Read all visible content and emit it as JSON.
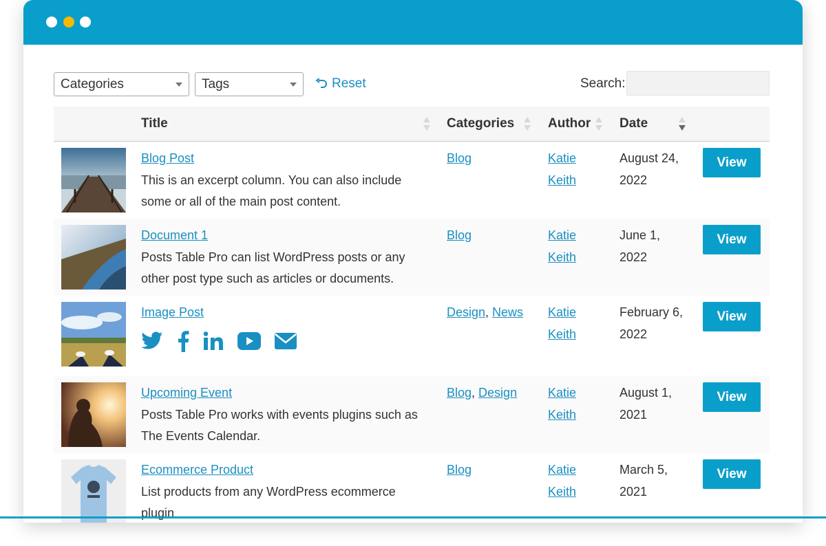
{
  "filters": {
    "categories_label": "Categories",
    "tags_label": "Tags",
    "reset_label": "Reset",
    "search_label": "Search:"
  },
  "table": {
    "columns": {
      "title": "Title",
      "categories": "Categories",
      "author": "Author",
      "date": "Date"
    },
    "view_label": "View",
    "rows": [
      {
        "title": "Blog Post",
        "excerpt": "This is an excerpt column. You can also include some or all of the main post content.",
        "categories": [
          "Blog"
        ],
        "author_first": "Katie",
        "author_last": "Keith",
        "date_line1": "August 24,",
        "date_line2": "2022",
        "thumb": "pier-photo"
      },
      {
        "title": "Document 1",
        "excerpt": "Posts Table Pro can list WordPress posts or any other post type such as articles or documents.",
        "categories": [
          "Blog"
        ],
        "author_first": "Katie",
        "author_last": "Keith",
        "date_line1": "June 1,",
        "date_line2": "2022",
        "thumb": "road-photo"
      },
      {
        "title": "Image Post",
        "excerpt": "",
        "categories": [
          "Design",
          "News"
        ],
        "author_first": "Katie",
        "author_last": "Keith",
        "date_line1": "February 6,",
        "date_line2": "2022",
        "thumb": "field-photo",
        "social_icons": [
          "twitter-icon",
          "facebook-icon",
          "linkedin-icon",
          "youtube-icon",
          "email-icon"
        ]
      },
      {
        "title": "Upcoming Event",
        "excerpt": "Posts Table Pro works with events plugins such as The Events Calendar.",
        "categories": [
          "Blog",
          "Design"
        ],
        "author_first": "Katie",
        "author_last": "Keith",
        "date_line1": "August 1,",
        "date_line2": "2021",
        "thumb": "sunset-photo"
      },
      {
        "title": "Ecommerce Product",
        "excerpt": "List products from any WordPress ecommerce plugin",
        "categories": [
          "Blog"
        ],
        "author_first": "Katie",
        "author_last": "Keith",
        "date_line1": "March 5,",
        "date_line2": "2021",
        "thumb": "tshirt-photo"
      }
    ]
  },
  "colors": {
    "accent": "#0a9fca",
    "link": "#1a8fc2",
    "window_dot_yellow": "#f5b800"
  }
}
